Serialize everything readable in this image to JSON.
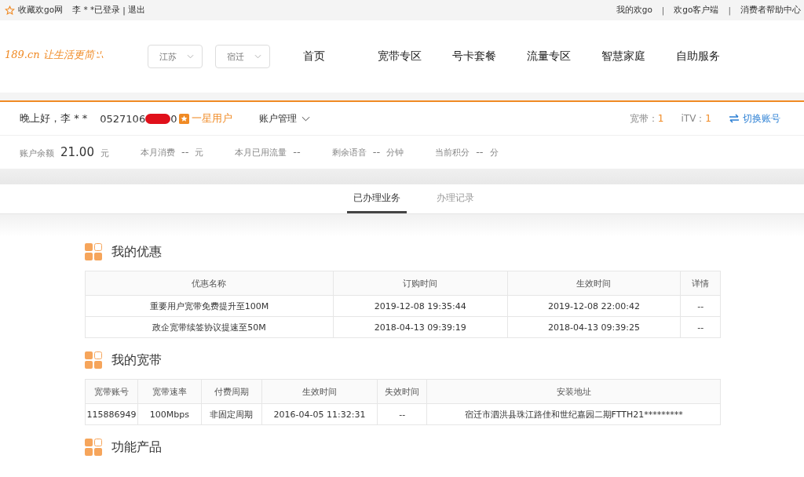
{
  "topbar": {
    "favorite": "收藏欢go网",
    "user": "李 * *已登录",
    "separator": "|",
    "logout": "退出",
    "links": [
      "我的欢go",
      "欢go客户端",
      "消费者帮助中心"
    ],
    "link_separators": [
      "|",
      "|"
    ]
  },
  "header": {
    "logo": "189.cn 让生活更简",
    "selects": [
      "江苏",
      "宿迁"
    ],
    "nav": [
      "首页",
      "宽带专区",
      "号卡套餐",
      "流量专区",
      "智慧家庭",
      "自助服务"
    ]
  },
  "account": {
    "greeting": "晚上好，李 * *",
    "phone_visible": [
      "0527106",
      "0"
    ],
    "level": "一星用户",
    "manage": "账户管理",
    "counts": [
      {
        "label": "宽带：",
        "value": "1"
      },
      {
        "label": "iTV：",
        "value": "1"
      }
    ],
    "switch": "切换账号",
    "stats": [
      {
        "label": "账户余额",
        "value": "21.00",
        "unit": "元"
      },
      {
        "label": "本月消费",
        "value": "--",
        "unit": "元"
      },
      {
        "label": "本月已用流量",
        "value": "--"
      },
      {
        "label": "剩余语音",
        "value": "--",
        "unit": "分钟"
      },
      {
        "label": "当前积分",
        "value": "--",
        "unit": "分"
      }
    ]
  },
  "tabs": [
    {
      "label": "已办理业务",
      "selected": true
    },
    {
      "label": "办理记录",
      "selected": false
    }
  ],
  "sections": [
    {
      "title": "我的优惠",
      "columns": [
        "优惠名称",
        "订购时间",
        "生效时间",
        "详情"
      ],
      "rows": [
        [
          "重要用户宽带免费提升至100M",
          "2019-12-08 19:35:44",
          "2019-12-08 22:00:42",
          "--"
        ],
        [
          "政企宽带续签协议提速至50M",
          "2018-04-13 09:39:19",
          "2018-04-13 09:39:25",
          "--"
        ]
      ]
    },
    {
      "title": "我的宽带",
      "columns": [
        "宽带账号",
        "宽带速率",
        "付费周期",
        "生效时间",
        "失效时间",
        "安装地址"
      ],
      "rows": [
        [
          "115886949",
          "100Mbps",
          "非固定周期",
          "2016-04-05 11:32:31",
          "--",
          "宿迁市泗洪县珠江路佳和世纪嘉园二期FTTH21*********"
        ]
      ]
    },
    {
      "title": "功能产品"
    }
  ]
}
